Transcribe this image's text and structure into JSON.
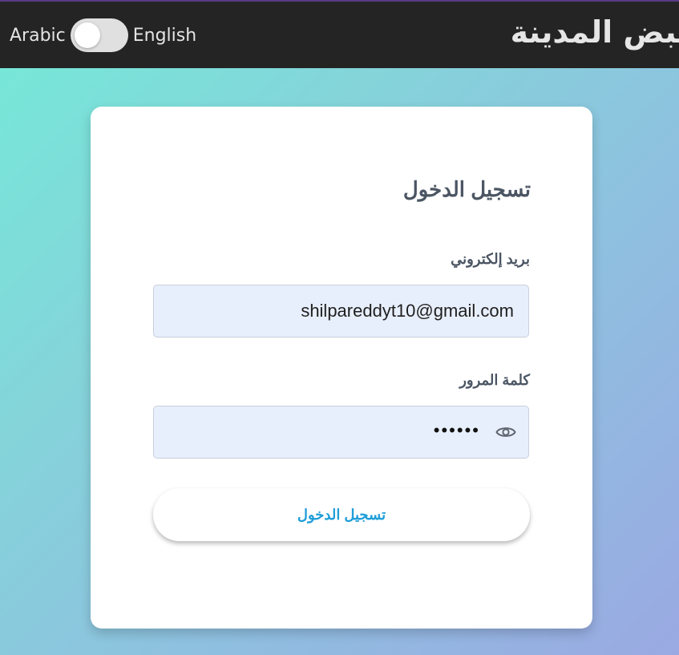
{
  "header": {
    "brand_title": "نبض المدينة",
    "language_toggle": {
      "left_label": "Arabic",
      "right_label": "English",
      "state": "off"
    }
  },
  "login_form": {
    "title": "تسجيل الدخول",
    "email": {
      "label": "بريد إلكتروني",
      "value": "shilpareddyt10@gmail.com"
    },
    "password": {
      "label": "كلمة المرور",
      "masked_value": "••••••",
      "toggle_icon": "eye-icon"
    },
    "submit_label": "تسجيل الدخول"
  },
  "colors": {
    "header_background": "#242424",
    "input_background": "#e8effc",
    "button_text": "#1f9ed8",
    "gradient_start": "#74ead8",
    "gradient_end": "#9aa9e2"
  }
}
